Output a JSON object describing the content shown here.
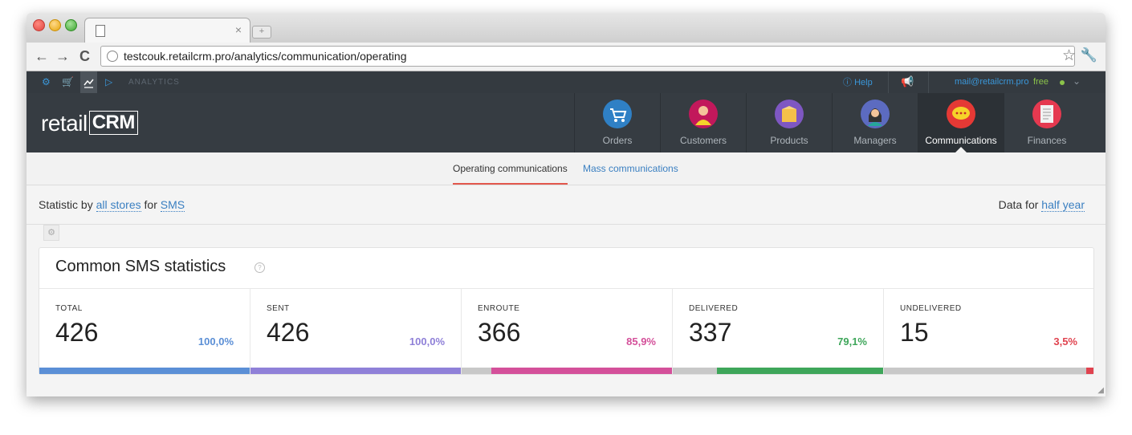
{
  "browser": {
    "url": "testcouk.retailcrm.pro/analytics/communication/operating",
    "tab_close": "×",
    "new_tab": "+"
  },
  "topbar": {
    "section_label": "ANALYTICS",
    "help_label": "Help",
    "account_email": "mail@retailcrm.pro",
    "plan": "free"
  },
  "header": {
    "logo_text": "retail",
    "logo_crm": "CRM",
    "menu": [
      {
        "label": "Orders",
        "icon": "cart-icon",
        "color": "#2f80c5"
      },
      {
        "label": "Customers",
        "icon": "customer-icon",
        "color": "#c2185b"
      },
      {
        "label": "Products",
        "icon": "box-icon",
        "color": "#7e57c2"
      },
      {
        "label": "Managers",
        "icon": "manager-icon",
        "color": "#5c6bc0"
      },
      {
        "label": "Communications",
        "icon": "chat-icon",
        "color": "#e53935"
      },
      {
        "label": "Finances",
        "icon": "finances-icon",
        "color": "#e53950"
      }
    ]
  },
  "subnav": {
    "active": "Operating communications",
    "other": "Mass communications"
  },
  "filter": {
    "prefix": "Statistic by",
    "stores": "all stores",
    "for": "for",
    "channel": "SMS",
    "data_for": "Data for",
    "period": "half year"
  },
  "card": {
    "title": "Common SMS statistics",
    "help": "?",
    "stats": [
      {
        "label": "TOTAL",
        "value": "426",
        "percent": "100,0%",
        "share": 1.0,
        "color": "#5b8fd6"
      },
      {
        "label": "SENT",
        "value": "426",
        "percent": "100,0%",
        "share": 1.0,
        "color": "#8f80d8"
      },
      {
        "label": "ENROUTE",
        "value": "366",
        "percent": "85,9%",
        "share": 0.859,
        "color": "#d4509a"
      },
      {
        "label": "DELIVERED",
        "value": "337",
        "percent": "79,1%",
        "share": 0.791,
        "color": "#3ea65a"
      },
      {
        "label": "UNDELIVERED",
        "value": "15",
        "percent": "3,5%",
        "share": 0.035,
        "color": "#e0434f"
      }
    ]
  }
}
